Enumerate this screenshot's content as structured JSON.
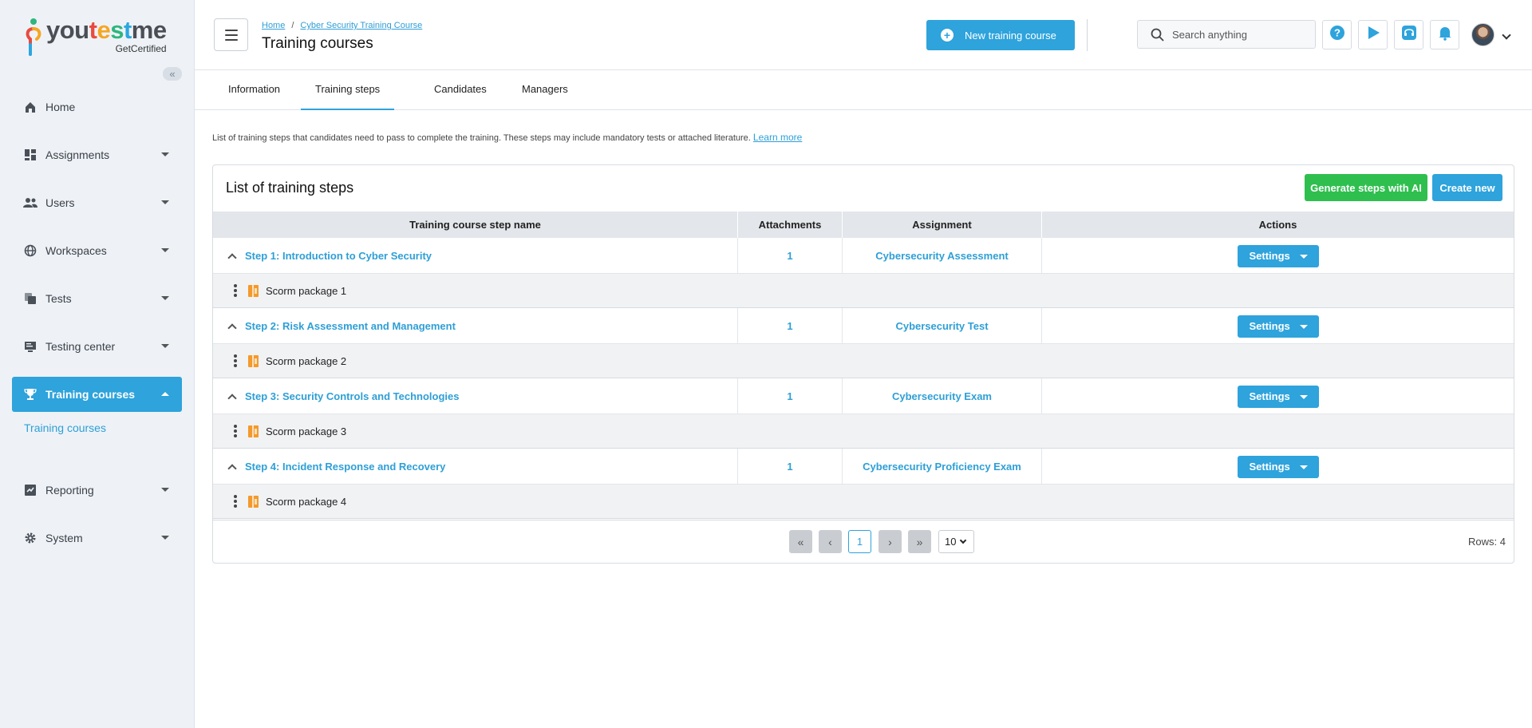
{
  "logo": {
    "word_parts": [
      "you",
      "t",
      "e",
      "s",
      "t",
      "me"
    ],
    "sub": "GetCertified"
  },
  "sidebar": {
    "items": [
      {
        "label": "Home",
        "icon": "home-icon",
        "has_caret": false
      },
      {
        "label": "Assignments",
        "icon": "dashboard-icon",
        "has_caret": true
      },
      {
        "label": "Users",
        "icon": "users-icon",
        "has_caret": true
      },
      {
        "label": "Workspaces",
        "icon": "globe-icon",
        "has_caret": true
      },
      {
        "label": "Tests",
        "icon": "copy-icon",
        "has_caret": true
      },
      {
        "label": "Testing center",
        "icon": "monitor-icon",
        "has_caret": true
      },
      {
        "label": "Training courses",
        "icon": "trophy-icon",
        "has_caret": true,
        "active": true
      },
      {
        "label": "Reporting",
        "icon": "report-icon",
        "has_caret": true
      },
      {
        "label": "System",
        "icon": "gear-icon",
        "has_caret": true
      }
    ],
    "sub_item": "Training courses"
  },
  "header": {
    "breadcrumb": {
      "home": "Home",
      "separator": "/",
      "current": "Cyber Security Training Course"
    },
    "title": "Training courses",
    "new_button": "New training course",
    "search_placeholder": "Search anything"
  },
  "tabs": [
    "Information",
    "Training steps",
    "Candidates",
    "Managers"
  ],
  "active_tab": "Training steps",
  "description": {
    "text": "List of training steps that candidates need to pass to complete the training. These steps may include mandatory tests or attached literature.",
    "link": "Learn more"
  },
  "card": {
    "title": "List of training steps",
    "generate_button": "Generate steps with AI",
    "create_button": "Create new"
  },
  "table": {
    "headers": [
      "Training course step name",
      "Attachments",
      "Assignment",
      "Actions"
    ],
    "rows": [
      {
        "name": "Step 1: Introduction to Cyber Security",
        "attachments": "1",
        "assignment": "Cybersecurity Assessment",
        "action": "Settings",
        "package": "Scorm package 1"
      },
      {
        "name": "Step 2: Risk Assessment and Management",
        "attachments": "1",
        "assignment": "Cybersecurity Test",
        "action": "Settings",
        "package": "Scorm package 2"
      },
      {
        "name": "Step 3: Security Controls and Technologies",
        "attachments": "1",
        "assignment": "Cybersecurity Exam",
        "action": "Settings",
        "package": "Scorm package 3"
      },
      {
        "name": "Step 4: Incident Response and Recovery",
        "attachments": "1",
        "assignment": "Cybersecurity Proficiency Exam",
        "action": "Settings",
        "package": "Scorm package 4"
      }
    ]
  },
  "pagination": {
    "page": "1",
    "page_size": "10",
    "rows_label": "Rows: 4"
  },
  "colors": {
    "accent": "#2ea3dc",
    "ai_button": "#2fbf4f",
    "package_icon": "#f39a2b"
  }
}
